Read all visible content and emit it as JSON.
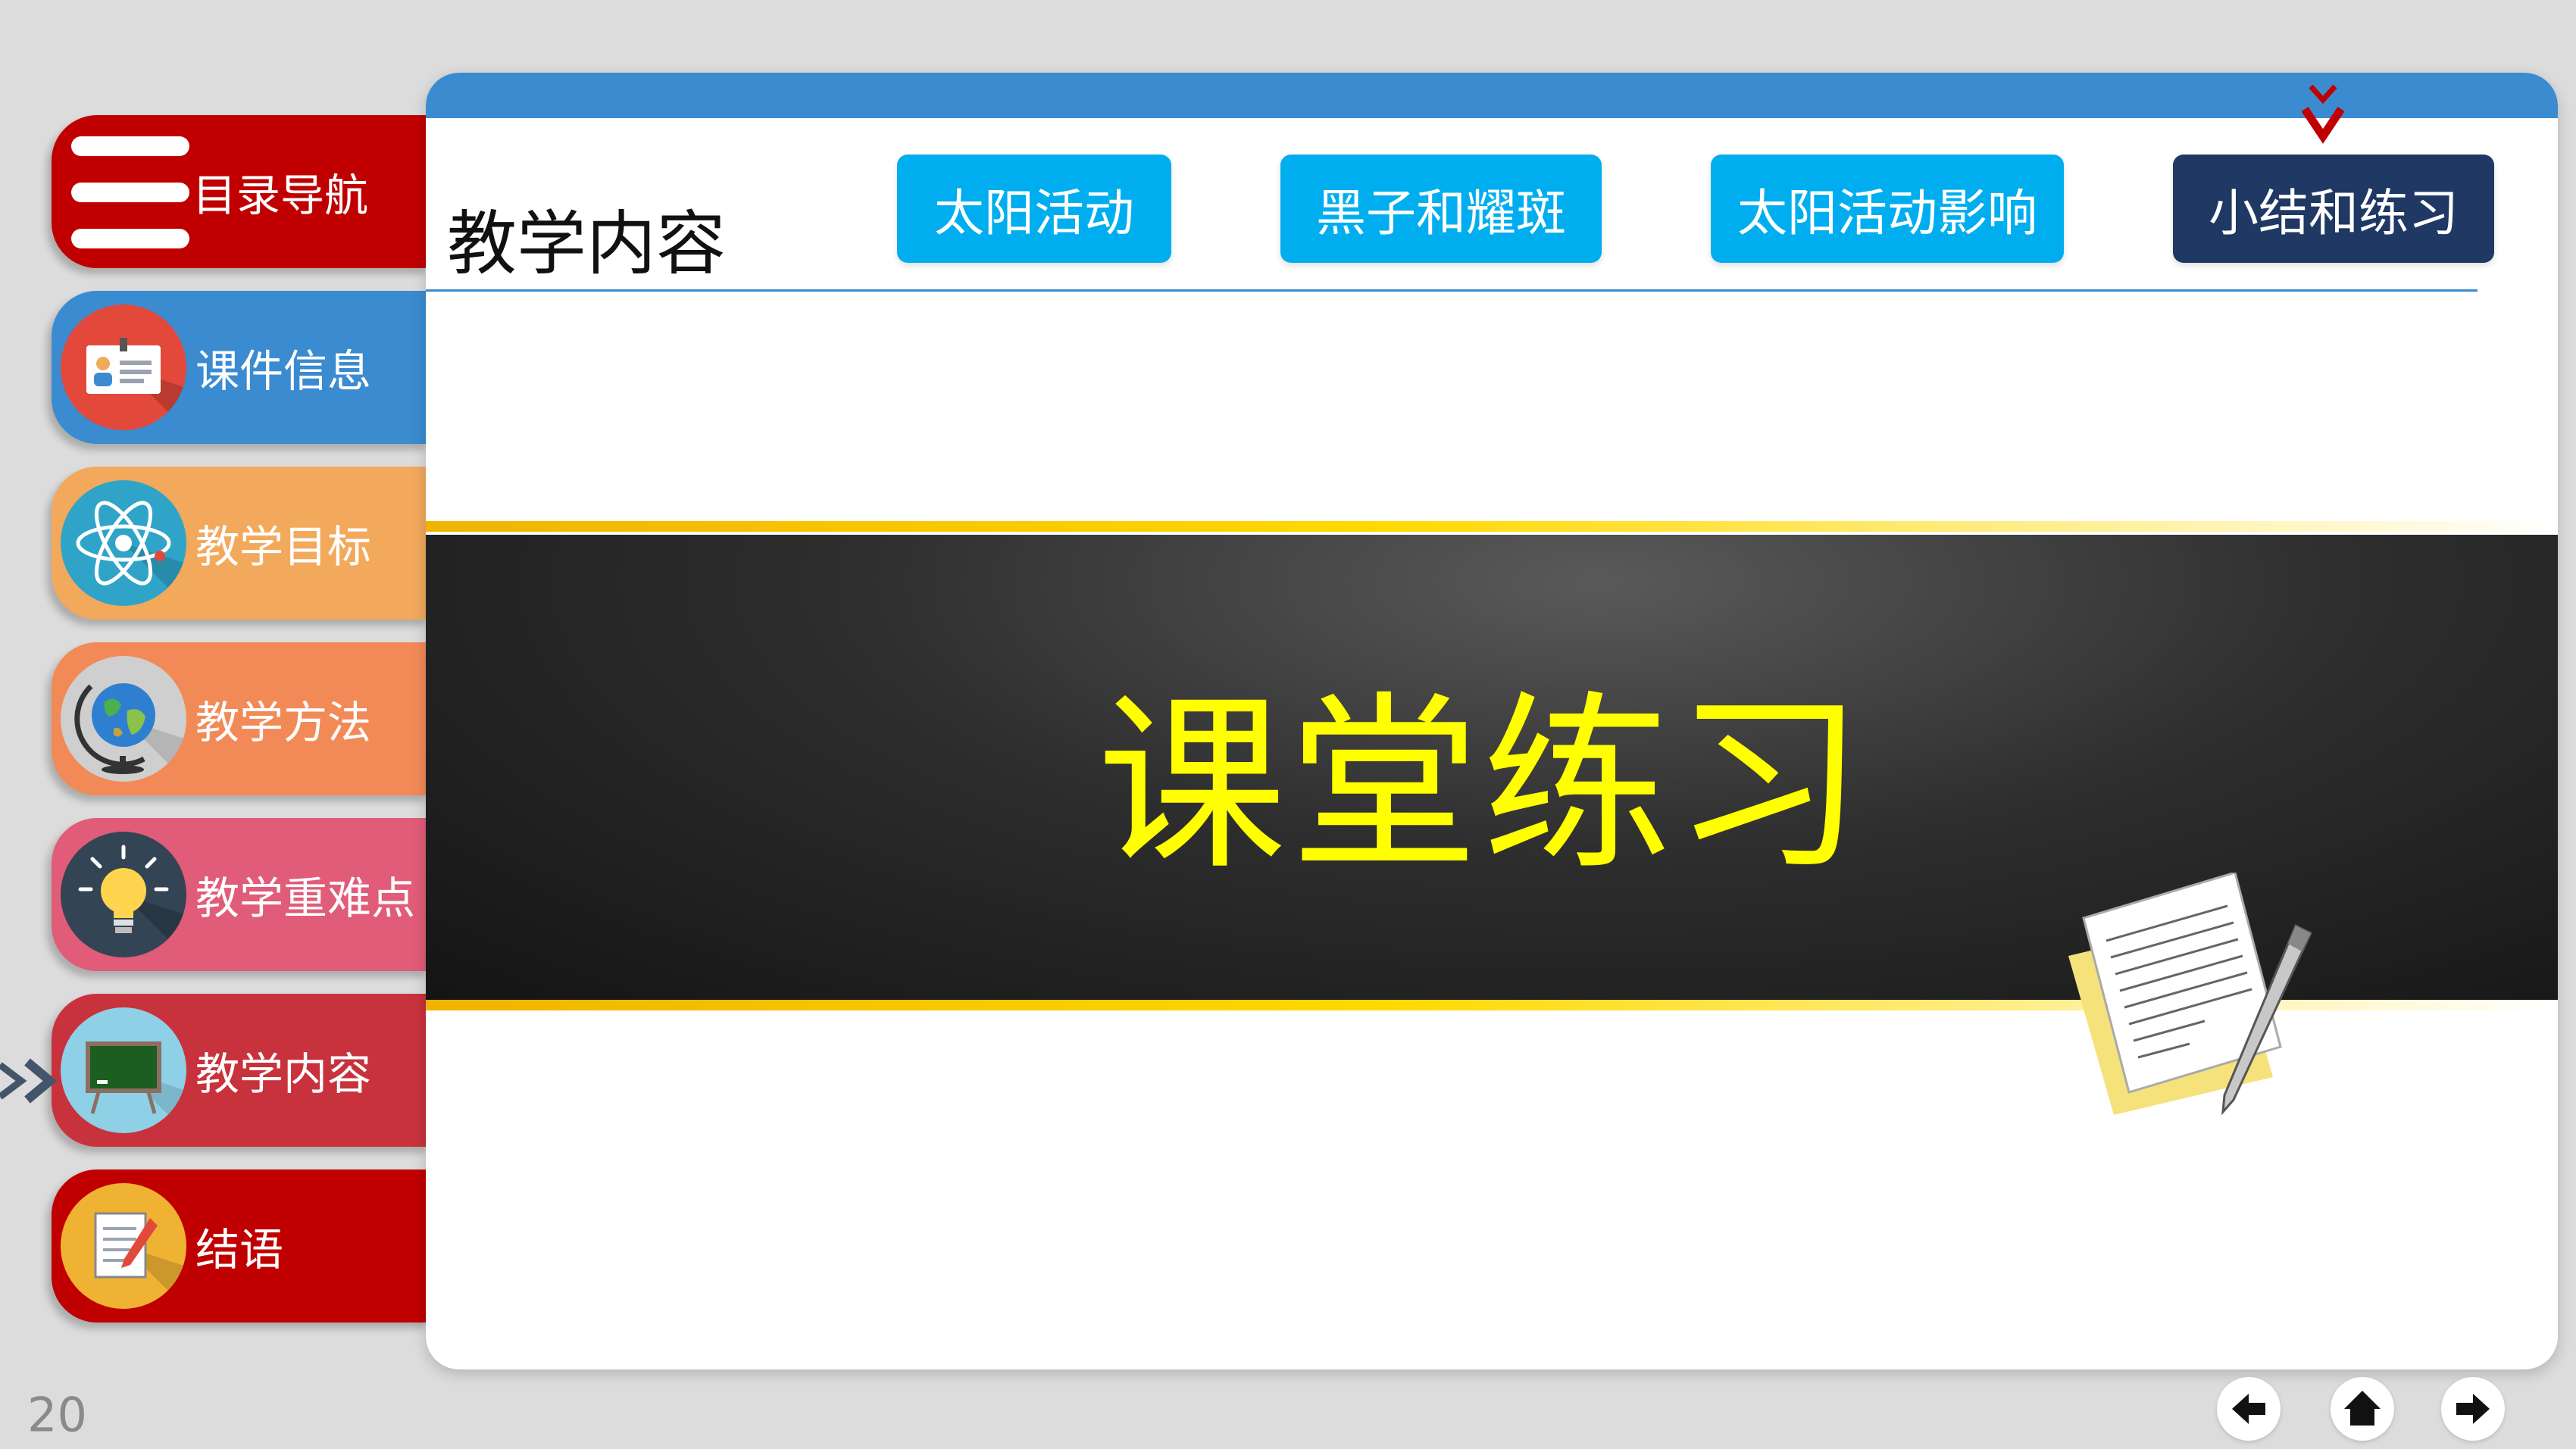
{
  "nav": {
    "items": [
      {
        "label": "目录导航",
        "color": "#c00000",
        "icon": "menu-icon"
      },
      {
        "label": "课件信息",
        "color": "#3b8bd0",
        "icon": "id-card-icon"
      },
      {
        "label": "教学目标",
        "color": "#f2a95c",
        "icon": "atom-icon"
      },
      {
        "label": "教学方法",
        "color": "#f28a58",
        "icon": "globe-icon"
      },
      {
        "label": "教学重难点",
        "color": "#e05c78",
        "icon": "lightbulb-icon"
      },
      {
        "label": "教学内容",
        "color": "#c8323c",
        "icon": "blackboard-icon",
        "selected": true
      },
      {
        "label": "结语",
        "color": "#c00000",
        "icon": "notepad-icon"
      }
    ]
  },
  "header": {
    "title": "教学内容",
    "tabs": [
      {
        "label": "太阳活动"
      },
      {
        "label": "黑子和耀斑"
      },
      {
        "label": "太阳活动影响"
      },
      {
        "label": "小结和练习",
        "active": true
      }
    ]
  },
  "banner": {
    "title": "课堂练习",
    "title_color": "#ffff00"
  },
  "footer": {
    "page_number": "20",
    "controls": [
      "previous-arrow-icon",
      "home-icon",
      "next-arrow-icon"
    ]
  }
}
